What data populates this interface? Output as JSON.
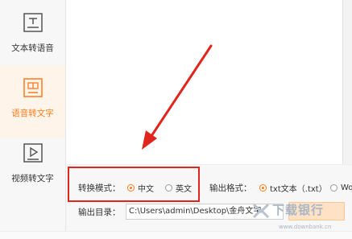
{
  "sidebar": {
    "items": [
      {
        "label": "文本转语音",
        "icon": "text-doc-icon",
        "active": false
      },
      {
        "label": "语音转文字",
        "icon": "voice-to-text-icon",
        "active": true
      },
      {
        "label": "视频转文字",
        "icon": "video-play-icon",
        "active": false
      }
    ]
  },
  "settings": {
    "mode_label": "转换模式：",
    "mode_options": [
      {
        "label": "中文",
        "selected": true
      },
      {
        "label": "英文",
        "selected": false
      }
    ],
    "format_label": "输出格式：",
    "format_options": [
      {
        "label": "txt文本（.txt）",
        "selected": true
      },
      {
        "label": "Wo",
        "selected": false
      }
    ],
    "dir_label": "输出目录：",
    "dir_value": "C:\\Users\\admin\\Desktop\\金舟文字"
  },
  "watermark": {
    "title": "下载银行",
    "url": "www.downbank.cn"
  },
  "colors": {
    "accent": "#ff7a1a",
    "highlight_border": "#e0261c",
    "arrow": "#e0261c"
  }
}
